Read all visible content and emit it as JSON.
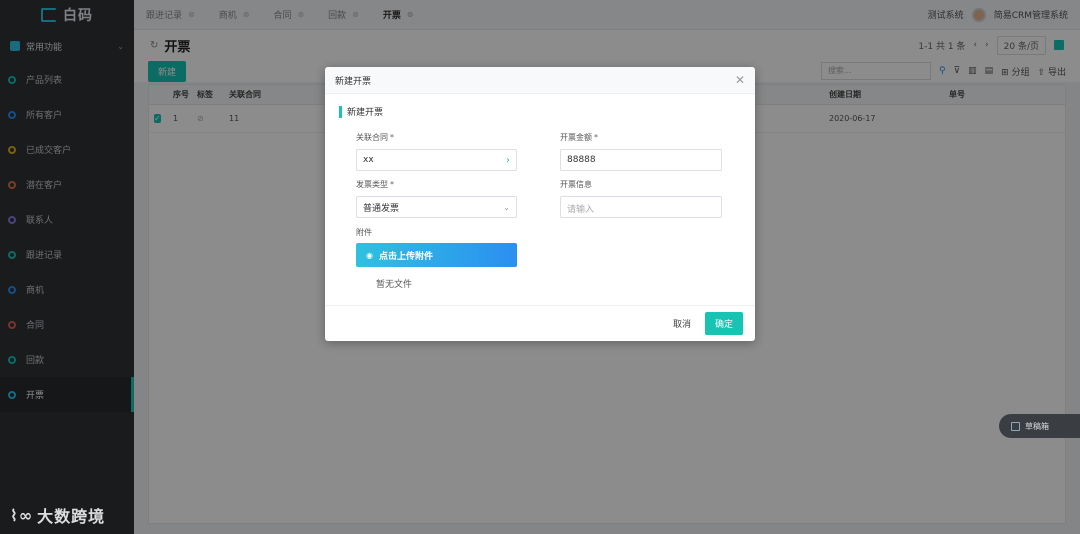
{
  "app": {
    "logo_text": "白码"
  },
  "sidebar": {
    "group_label": "常用功能",
    "items": [
      {
        "label": "产品列表",
        "color": "#17c3b2"
      },
      {
        "label": "所有客户",
        "color": "#2b8ff0"
      },
      {
        "label": "已成交客户",
        "color": "#e0b020"
      },
      {
        "label": "潜在客户",
        "color": "#e07040"
      },
      {
        "label": "联系人",
        "color": "#8a7ae0"
      },
      {
        "label": "跟进记录",
        "color": "#17c3b2"
      },
      {
        "label": "商机",
        "color": "#2b8ff0"
      },
      {
        "label": "合同",
        "color": "#e06050"
      },
      {
        "label": "回款",
        "color": "#17c3b2"
      },
      {
        "label": "开票",
        "color": "#2ec4e5"
      }
    ]
  },
  "tabs": [
    "跟进记录",
    "商机",
    "合同",
    "回款",
    "开票"
  ],
  "header": {
    "test_system": "测试系统",
    "system_name": "简易CRM管理系统"
  },
  "page": {
    "title": "开票",
    "pager_text": "1-1 共 1 条",
    "page_size": "20 条/页",
    "new_button": "新建",
    "search_placeholder": "搜索...",
    "group_label": "分组",
    "export_label": "导出"
  },
  "table": {
    "headers": [
      "序号",
      "标签",
      "关联合同",
      "创建日期",
      "单号"
    ],
    "row": {
      "index": "1",
      "contract": "11",
      "created": "2020-06-17"
    }
  },
  "modal": {
    "title": "新建开票",
    "section": "新建开票",
    "contract_label": "关联合同",
    "contract_value": "xx",
    "amount_label": "开票金额",
    "amount_value": "88888",
    "type_label": "发票类型",
    "type_value": "普通发票",
    "info_label": "开票信息",
    "info_placeholder": "请输入",
    "attach_label": "附件",
    "upload_label": "点击上传附件",
    "no_file": "暂无文件",
    "cancel": "取消",
    "ok": "确定",
    "required_mark": "*"
  },
  "draft_label": "草稿箱",
  "watermark": "大数跨境",
  "icons": {
    "close": "close-icon",
    "refresh": "refresh-icon",
    "search": "search-icon",
    "eye": "eye-icon"
  }
}
